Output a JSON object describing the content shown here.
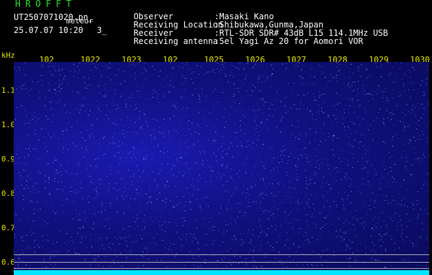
{
  "header": {
    "title": "HROFFT",
    "filename": "UT2507071020.pn_",
    "mode": "meteor",
    "datetime": "25.07.07 10:20",
    "count": "3_"
  },
  "meta": [
    {
      "label": "Observer",
      "value": ":Masaki Kano"
    },
    {
      "label": "Receiving Location",
      "value": ":Shibukawa,Gunma,Japan"
    },
    {
      "label": "Receiver",
      "value": ":RTL-SDR SDR# 43dB L15 114.1MHz USB"
    },
    {
      "label": "Receiving antenna",
      "value": ":5el Yagi Az 20 for Aomori VOR"
    }
  ],
  "waterfall": {
    "unit": "kHz",
    "x_ticks": [
      "102",
      "1022",
      "1023",
      "102",
      "1025",
      "1026",
      "1027",
      "1028",
      "1029",
      "1030"
    ],
    "y_ticks": [
      "1.1",
      "1.0",
      "0.9",
      "0.8",
      "0.7",
      "0.6"
    ],
    "colors": {
      "background": "#0a0a5c",
      "noise": "#4a6cff",
      "axis_text": "#e6e600",
      "floor": "#00e5ff",
      "title": "#22e322"
    }
  }
}
